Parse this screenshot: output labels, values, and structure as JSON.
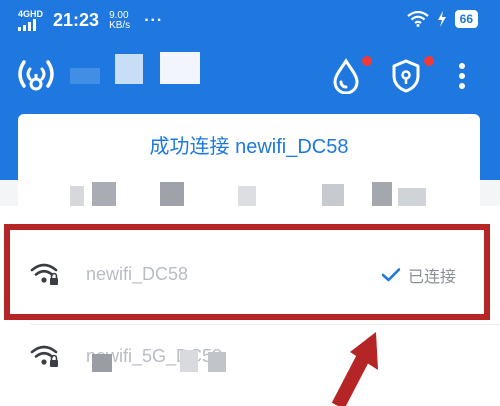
{
  "status_bar": {
    "network": "4GHD",
    "time": "21:23",
    "speed_value": "9.00",
    "speed_unit": "KB/s",
    "more": "···",
    "battery": "66",
    "icons": [
      "signal-icon",
      "wifi-icon",
      "charging-icon",
      "battery-icon"
    ]
  },
  "app_bar": {
    "icons": [
      "app-logo-icon",
      "water-drop-icon",
      "shield-icon",
      "more-vert-icon"
    ]
  },
  "card": {
    "title": "成功连接 newifi_DC58"
  },
  "wifi_list": [
    {
      "name": "newifi_DC58",
      "status": "已连接",
      "icon": "wifi-lock-icon",
      "highlighted": true
    },
    {
      "name": "newifi_5G_DC58",
      "status": "",
      "icon": "wifi-lock-icon",
      "highlighted": false
    }
  ],
  "colors": {
    "brand_blue": "#1f78e0",
    "highlight_red": "#b52525",
    "badge_red": "#f03a3a"
  }
}
